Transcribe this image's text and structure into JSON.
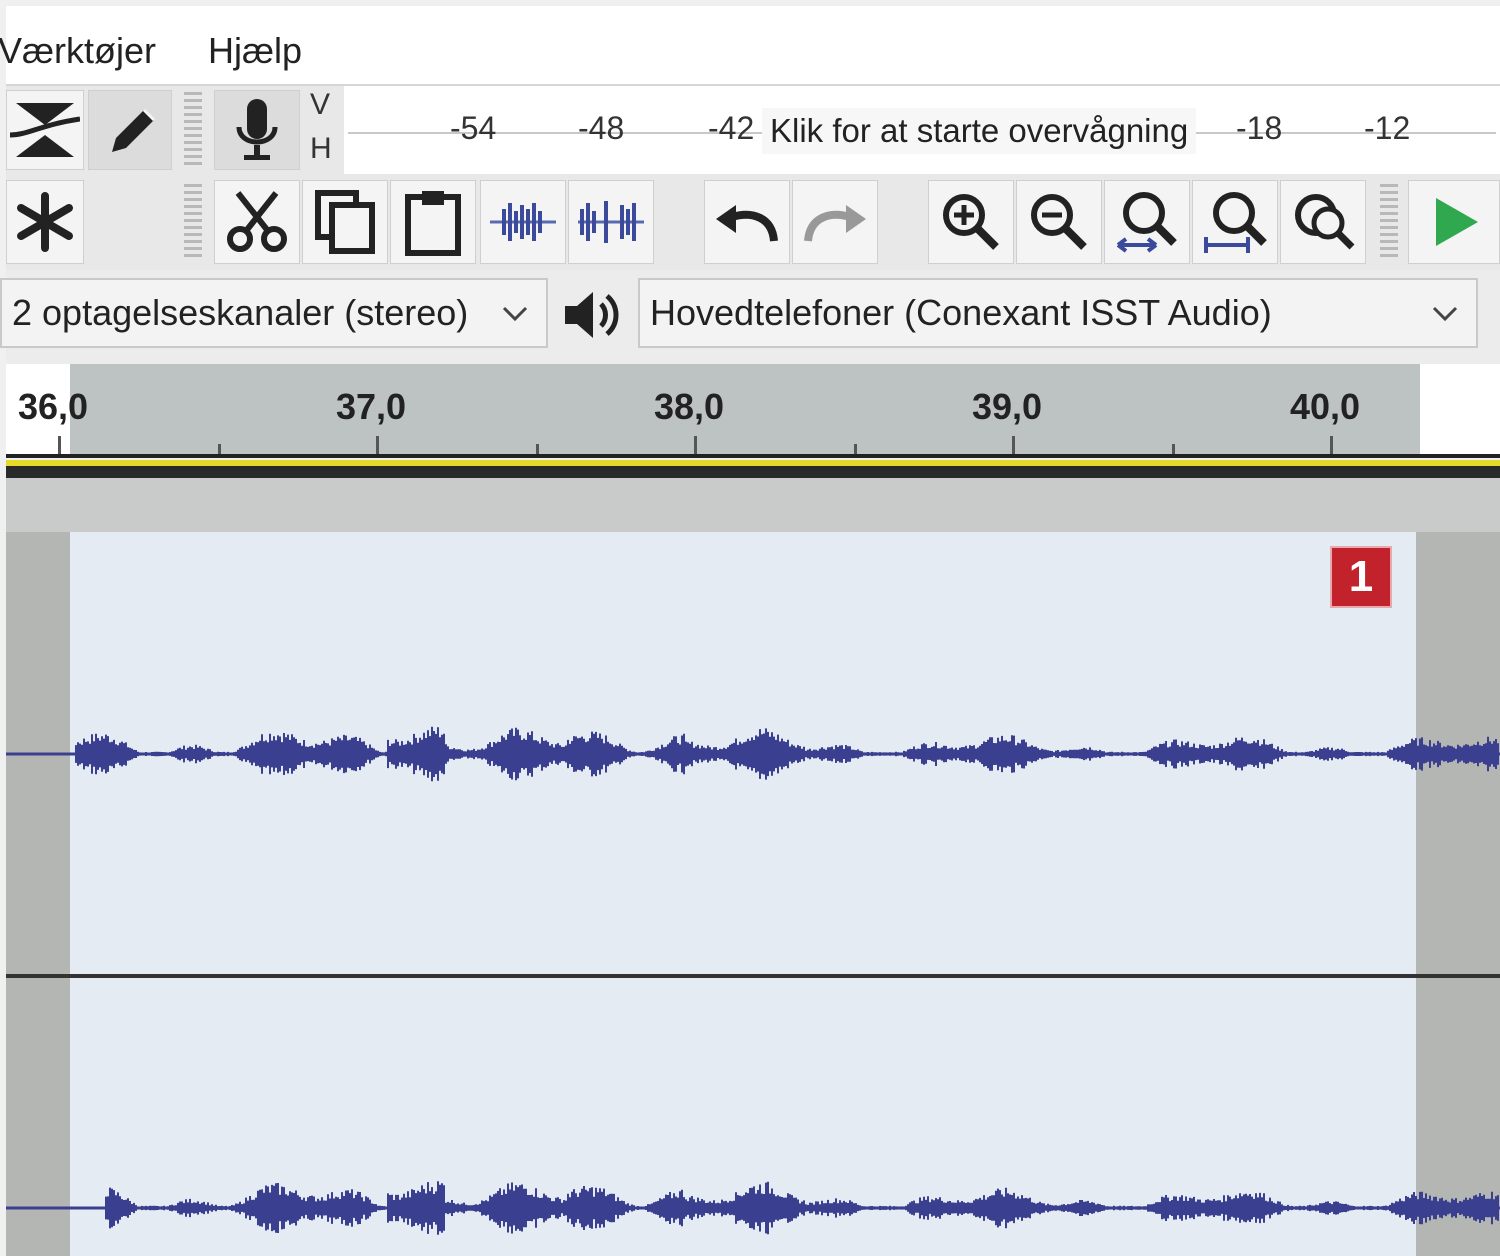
{
  "menu": {
    "items": [
      "Værktøjer",
      "Hjælp"
    ]
  },
  "meter": {
    "channels": [
      "V",
      "H"
    ],
    "ticks": [
      "-54",
      "-48",
      "-42",
      "-18",
      "-12"
    ],
    "tooltip": "Klik for at starte overvågning"
  },
  "devices": {
    "input_channels": "2 optagelseskanaler (stereo)",
    "output_device": "Hovedtelefoner (Conexant ISST Audio)"
  },
  "ruler": {
    "labels": [
      "36,0",
      "37,0",
      "38,0",
      "39,0",
      "40,0"
    ]
  },
  "track": {
    "clip_badge": "1"
  },
  "colors": {
    "waveform": "#3b3f8f",
    "clip_background": "#e4ebf2",
    "badge": "#c1222b",
    "play": "#2fa84f"
  },
  "icons": [
    "envelope-tool-icon",
    "draw-tool-icon",
    "multi-tool-icon",
    "microphone-icon",
    "cut-icon",
    "copy-icon",
    "paste-icon",
    "trim-icon",
    "silence-icon",
    "undo-icon",
    "redo-icon",
    "zoom-in-icon",
    "zoom-out-icon",
    "fit-selection-icon",
    "fit-project-icon",
    "zoom-toggle-icon",
    "play-icon",
    "speaker-icon"
  ]
}
